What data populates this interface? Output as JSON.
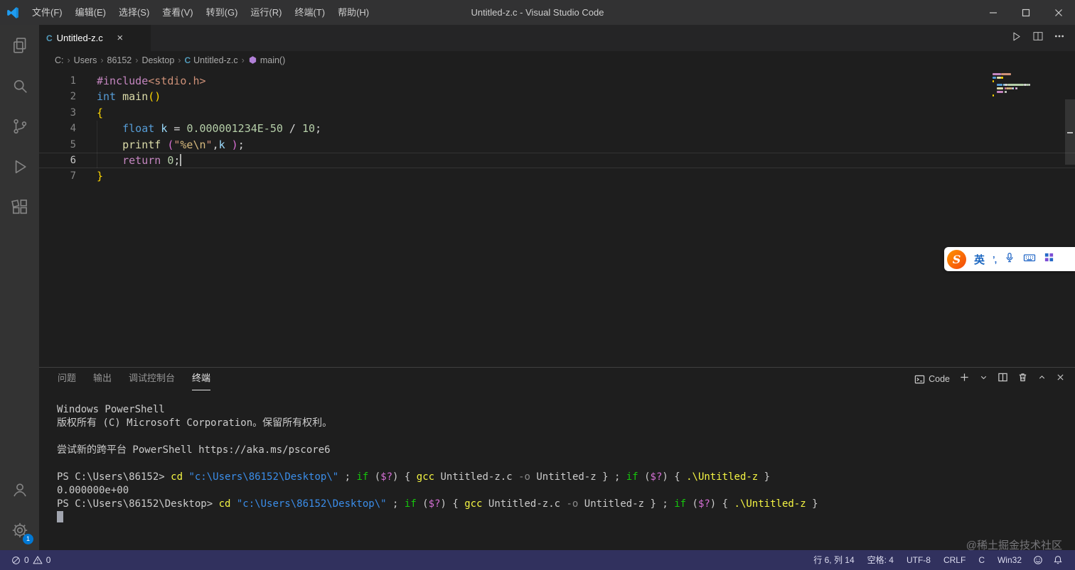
{
  "colors": {
    "statusbar_bg": "#31315E",
    "activity_badge": "#0078D4",
    "syntax": {
      "pp": "#C586C0",
      "str": "#CE9178",
      "kw": "#569CD6",
      "fn": "#DCDCAA",
      "var": "#9CDCFE",
      "num": "#B5CEA8",
      "pl": "#D4D4D4",
      "b1": "#FFD700",
      "b2": "#DA70D6",
      "esc": "#D7BA7D"
    },
    "terminal": {
      "pl": "#CCCCCC",
      "cmd": "#F5F543",
      "str": "#3B8EEA",
      "kw": "#16C60C",
      "var": "#D670D6",
      "param": "#8A8A8A"
    }
  },
  "title_bar": {
    "title": "Untitled-z.c - Visual Studio Code",
    "menus": [
      {
        "id": "file",
        "label": "文件(F)"
      },
      {
        "id": "edit",
        "label": "编辑(E)"
      },
      {
        "id": "selection",
        "label": "选择(S)"
      },
      {
        "id": "view",
        "label": "查看(V)"
      },
      {
        "id": "goto",
        "label": "转到(G)"
      },
      {
        "id": "run",
        "label": "运行(R)"
      },
      {
        "id": "terminal",
        "label": "终端(T)"
      },
      {
        "id": "help",
        "label": "帮助(H)"
      }
    ]
  },
  "activity_bar": {
    "settings_badge": "1"
  },
  "tab_bar": {
    "tabs": [
      {
        "label": "Untitled-z.c"
      }
    ]
  },
  "breadcrumb": {
    "items": [
      {
        "label": "C:"
      },
      {
        "label": "Users"
      },
      {
        "label": "86152"
      },
      {
        "label": "Desktop"
      },
      {
        "label": "Untitled-z.c",
        "icon": "c-file"
      },
      {
        "label": "main()",
        "icon": "symbol-method"
      }
    ]
  },
  "editor": {
    "cursor_line": 6,
    "cursor_col": 14,
    "lines": [
      {
        "num": "1",
        "segments": [
          {
            "t": "#include",
            "c": "pp"
          },
          {
            "t": "<stdio.h>",
            "c": "str"
          }
        ]
      },
      {
        "num": "2",
        "segments": [
          {
            "t": "int",
            "c": "kw"
          },
          {
            "t": " ",
            "c": "pl"
          },
          {
            "t": "main",
            "c": "fn"
          },
          {
            "t": "()",
            "c": "b1"
          }
        ]
      },
      {
        "num": "3",
        "segments": [
          {
            "t": "{",
            "c": "b1"
          }
        ]
      },
      {
        "num": "4",
        "segments": [
          {
            "t": "    ",
            "c": "pl"
          },
          {
            "t": "float",
            "c": "kw"
          },
          {
            "t": " ",
            "c": "pl"
          },
          {
            "t": "k",
            "c": "var"
          },
          {
            "t": " = ",
            "c": "pl"
          },
          {
            "t": "0.000001234E-50",
            "c": "num"
          },
          {
            "t": " / ",
            "c": "pl"
          },
          {
            "t": "10",
            "c": "num"
          },
          {
            "t": ";",
            "c": "pl"
          }
        ]
      },
      {
        "num": "5",
        "segments": [
          {
            "t": "    ",
            "c": "pl"
          },
          {
            "t": "printf",
            "c": "fn"
          },
          {
            "t": " ",
            "c": "pl"
          },
          {
            "t": "(",
            "c": "b2"
          },
          {
            "t": "\"",
            "c": "str"
          },
          {
            "t": "%e",
            "c": "esc"
          },
          {
            "t": "\\n",
            "c": "esc"
          },
          {
            "t": "\"",
            "c": "str"
          },
          {
            "t": ",",
            "c": "pl"
          },
          {
            "t": "k",
            "c": "var"
          },
          {
            "t": " ",
            "c": "pl"
          },
          {
            "t": ")",
            "c": "b2"
          },
          {
            "t": ";",
            "c": "pl"
          }
        ]
      },
      {
        "num": "6",
        "active": true,
        "segments": [
          {
            "t": "    ",
            "c": "pl"
          },
          {
            "t": "return",
            "c": "pp"
          },
          {
            "t": " ",
            "c": "pl"
          },
          {
            "t": "0",
            "c": "num"
          },
          {
            "t": ";",
            "c": "pl"
          }
        ]
      },
      {
        "num": "7",
        "segments": [
          {
            "t": "}",
            "c": "b1"
          }
        ]
      }
    ]
  },
  "panel": {
    "tabs": [
      {
        "id": "problems",
        "label": "问题",
        "active": false
      },
      {
        "id": "output",
        "label": "输出",
        "active": false
      },
      {
        "id": "debug-console",
        "label": "调试控制台",
        "active": false
      },
      {
        "id": "terminal",
        "label": "终端",
        "active": true
      }
    ],
    "profile_label": "Code"
  },
  "terminal": {
    "lines": [
      {
        "segments": [
          {
            "t": "Windows PowerShell",
            "c": "pl"
          }
        ]
      },
      {
        "segments": [
          {
            "t": "版权所有 (C) Microsoft Corporation。保留所有权利。",
            "c": "pl"
          }
        ]
      },
      {
        "segments": []
      },
      {
        "segments": [
          {
            "t": "尝试新的跨平台 PowerShell https://aka.ms/pscore6",
            "c": "pl"
          }
        ]
      },
      {
        "segments": []
      },
      {
        "segments": [
          {
            "t": "PS C:\\Users\\86152> ",
            "c": "pl"
          },
          {
            "t": "cd",
            "c": "cmd"
          },
          {
            "t": " ",
            "c": "pl"
          },
          {
            "t": "\"c:\\Users\\86152\\Desktop\\\"",
            "c": "str"
          },
          {
            "t": " ; ",
            "c": "pl"
          },
          {
            "t": "if",
            "c": "kw"
          },
          {
            "t": " (",
            "c": "pl"
          },
          {
            "t": "$?",
            "c": "var"
          },
          {
            "t": ") { ",
            "c": "pl"
          },
          {
            "t": "gcc",
            "c": "cmd"
          },
          {
            "t": " Untitled-z.c ",
            "c": "pl"
          },
          {
            "t": "-o",
            "c": "param"
          },
          {
            "t": " Untitled-z } ; ",
            "c": "pl"
          },
          {
            "t": "if",
            "c": "kw"
          },
          {
            "t": " (",
            "c": "pl"
          },
          {
            "t": "$?",
            "c": "var"
          },
          {
            "t": ") { ",
            "c": "pl"
          },
          {
            "t": ".\\Untitled-z",
            "c": "cmd"
          },
          {
            "t": " }",
            "c": "pl"
          }
        ]
      },
      {
        "segments": [
          {
            "t": "0.000000e+00",
            "c": "pl"
          }
        ]
      },
      {
        "segments": [
          {
            "t": "PS C:\\Users\\86152\\Desktop> ",
            "c": "pl"
          },
          {
            "t": "cd",
            "c": "cmd"
          },
          {
            "t": " ",
            "c": "pl"
          },
          {
            "t": "\"c:\\Users\\86152\\Desktop\\\"",
            "c": "str"
          },
          {
            "t": " ; ",
            "c": "pl"
          },
          {
            "t": "if",
            "c": "kw"
          },
          {
            "t": " (",
            "c": "pl"
          },
          {
            "t": "$?",
            "c": "var"
          },
          {
            "t": ") { ",
            "c": "pl"
          },
          {
            "t": "gcc",
            "c": "cmd"
          },
          {
            "t": " Untitled-z.c ",
            "c": "pl"
          },
          {
            "t": "-o",
            "c": "param"
          },
          {
            "t": " Untitled-z } ; ",
            "c": "pl"
          },
          {
            "t": "if",
            "c": "kw"
          },
          {
            "t": " (",
            "c": "pl"
          },
          {
            "t": "$?",
            "c": "var"
          },
          {
            "t": ") { ",
            "c": "pl"
          },
          {
            "t": ".\\Untitled-z",
            "c": "cmd"
          },
          {
            "t": " }",
            "c": "pl"
          }
        ]
      },
      {
        "cursor": true,
        "segments": []
      }
    ]
  },
  "status_bar": {
    "errors": "0",
    "warnings": "0",
    "items": [
      {
        "id": "cursor-position",
        "label": "行 6, 列 14"
      },
      {
        "id": "indentation",
        "label": "空格: 4"
      },
      {
        "id": "encoding",
        "label": "UTF-8"
      },
      {
        "id": "eol",
        "label": "CRLF"
      },
      {
        "id": "language-mode",
        "label": "C"
      },
      {
        "id": "platform",
        "label": "Win32"
      }
    ]
  },
  "ime": {
    "mode": "英"
  },
  "watermark": "@稀土掘金技术社区"
}
